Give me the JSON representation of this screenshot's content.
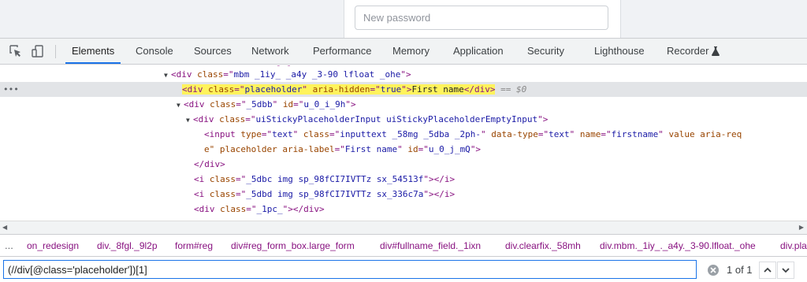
{
  "page": {
    "password_placeholder": "New password"
  },
  "devtools": {
    "toolbar_icons": [
      "inspect-element-icon",
      "device-toolbar-icon"
    ],
    "tabs": [
      {
        "label": "Elements",
        "active": true
      },
      {
        "label": "Console"
      },
      {
        "label": "Sources"
      },
      {
        "label": "Network"
      },
      {
        "label": "Performance"
      },
      {
        "label": "Memory"
      },
      {
        "label": "Application"
      },
      {
        "label": "Security"
      },
      {
        "label": "Lighthouse"
      },
      {
        "label": "Recorder",
        "icon": "flask-icon"
      }
    ],
    "tree": {
      "partial_top": "- -",
      "line1": {
        "tag_open": "<div ",
        "attr": "class",
        "eq": "=\"",
        "val": "mbm _1iy_ _a4y _3-90 lfloat _ohe",
        "close": "\">"
      },
      "line2": {
        "tag_open": "<div ",
        "a1": "class",
        "v1": "placeholder",
        "a2": "aria-hidden",
        "v2": "true",
        "text": "First name",
        "tag_close": "</div>",
        "suffix": "== $0"
      },
      "line3": {
        "tag_open": "<div ",
        "a1": "class",
        "v1": "_5dbb",
        "a2": "id",
        "v2": "u_0_i_9h"
      },
      "line4": {
        "tag_open": "<div ",
        "a1": "class",
        "v1": "uiStickyPlaceholderInput uiStickyPlaceholderEmptyInput"
      },
      "line5": {
        "tag_open": "<input ",
        "a1": "type",
        "v1": "text",
        "a2": "class",
        "v2": "inputtext _58mg _5dba _2ph-",
        "a3": "data-type",
        "v3": "text",
        "a4": "name",
        "v4": "firstname",
        "a5": "value",
        "a6": "aria-req"
      },
      "line6": {
        "lead": "e\"",
        "a1": "placeholder",
        "a2": "aria-label",
        "v2": "First name",
        "a3": "id",
        "v3": "u_0_j_mQ"
      },
      "line7": "</div>",
      "line8": {
        "tag_open": "<i ",
        "a1": "class",
        "v1": "_5dbc img sp_98fCI7IVTTz sx_54513f",
        "close": "</i>"
      },
      "line9": {
        "tag_open": "<i ",
        "a1": "class",
        "v1": "_5dbd img sp_98fCI7IVTTz sx_336c7a",
        "close": "</i>"
      },
      "line10": {
        "tag_open": "<div ",
        "a1": "class",
        "v1": "_1pc_",
        "close": "</div>"
      }
    },
    "gutter_dots": "•••",
    "breadcrumbs": {
      "more": "...",
      "items": [
        "on_redesign",
        "div._8fgl._9l2p",
        "form#reg",
        "div#reg_form_box.large_form",
        "div#fullname_field._1ixn",
        "div.clearfix._58mh",
        "div.mbm._1iy_._a4y._3-90.lfloat._ohe",
        "div.pla"
      ]
    },
    "search": {
      "query": "(//div[@class='placeholder'])[1]",
      "match_count": "1 of 1"
    }
  }
}
